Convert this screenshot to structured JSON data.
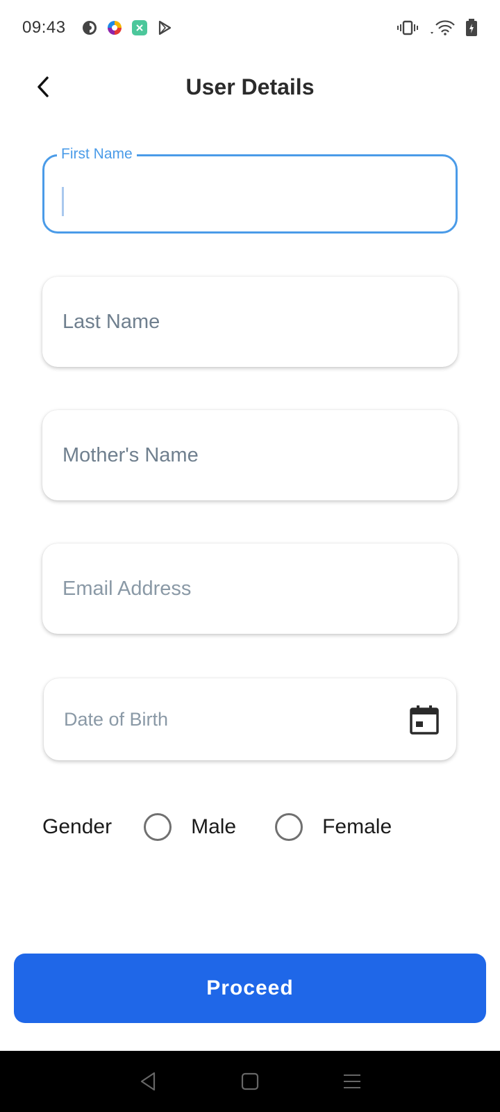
{
  "status_bar": {
    "time": "09:43",
    "notification_icons": [
      "circle-half-icon",
      "colorful-app-icon",
      "green-app-icon",
      "play-store-icon"
    ],
    "system_icons": [
      "vibrate-icon",
      "wifi-icon",
      "battery-charging-icon"
    ]
  },
  "header": {
    "title": "User Details",
    "back_icon": "chevron-left-icon"
  },
  "form": {
    "first_name": {
      "label": "First Name",
      "value": "",
      "focused": true
    },
    "last_name": {
      "placeholder": "Last Name",
      "value": ""
    },
    "mothers_name": {
      "placeholder": "Mother's Name",
      "value": ""
    },
    "email": {
      "placeholder": "Email Address",
      "value": ""
    },
    "dob": {
      "placeholder": "Date of Birth",
      "value": "",
      "icon": "calendar-icon"
    },
    "gender": {
      "label": "Gender",
      "options": [
        {
          "label": "Male",
          "selected": false
        },
        {
          "label": "Female",
          "selected": false
        }
      ]
    }
  },
  "proceed_label": "Proceed",
  "nav_bar": {
    "buttons": [
      "back-triangle-icon",
      "home-square-icon",
      "menu-lines-icon"
    ]
  },
  "colors": {
    "accent": "#1f67e8",
    "focus_border": "#4a9be8",
    "placeholder": "#6f7f8e"
  }
}
